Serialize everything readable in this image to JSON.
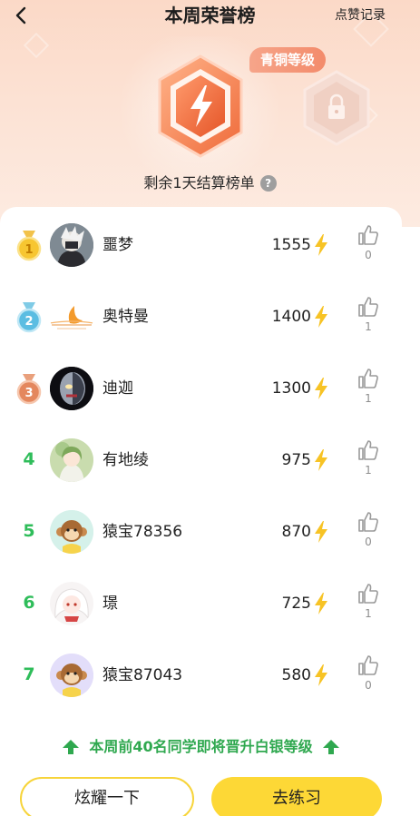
{
  "header": {
    "title": "本周荣誉榜",
    "like_record": "点赞记录"
  },
  "badge": {
    "level_tag": "青铜等级",
    "settle_text": "剩余1天结算榜单",
    "help": "?"
  },
  "ranking": [
    {
      "rank": "1",
      "name": "噩梦",
      "score": "1555",
      "likes": "0",
      "medal": "gold"
    },
    {
      "rank": "2",
      "name": "奥特曼",
      "score": "1400",
      "likes": "1",
      "medal": "silver"
    },
    {
      "rank": "3",
      "name": "迪迦",
      "score": "1300",
      "likes": "1",
      "medal": "bronze"
    },
    {
      "rank": "4",
      "name": "有地绫",
      "score": "975",
      "likes": "1"
    },
    {
      "rank": "5",
      "name": "猿宝78356",
      "score": "870",
      "likes": "0"
    },
    {
      "rank": "6",
      "name": "璟",
      "score": "725",
      "likes": "1"
    },
    {
      "rank": "7",
      "name": "猿宝87043",
      "score": "580",
      "likes": "0"
    }
  ],
  "promo": {
    "text": "本周前40名同学即将晋升白银等级"
  },
  "footer": {
    "show_button": "炫耀一下",
    "practice_button": "去练习"
  },
  "colors": {
    "rank_green": "#2fbd5a",
    "button_yellow": "#fdd836",
    "bolt_yellow": "#f7c325",
    "badge_orange": "#f3713f"
  }
}
